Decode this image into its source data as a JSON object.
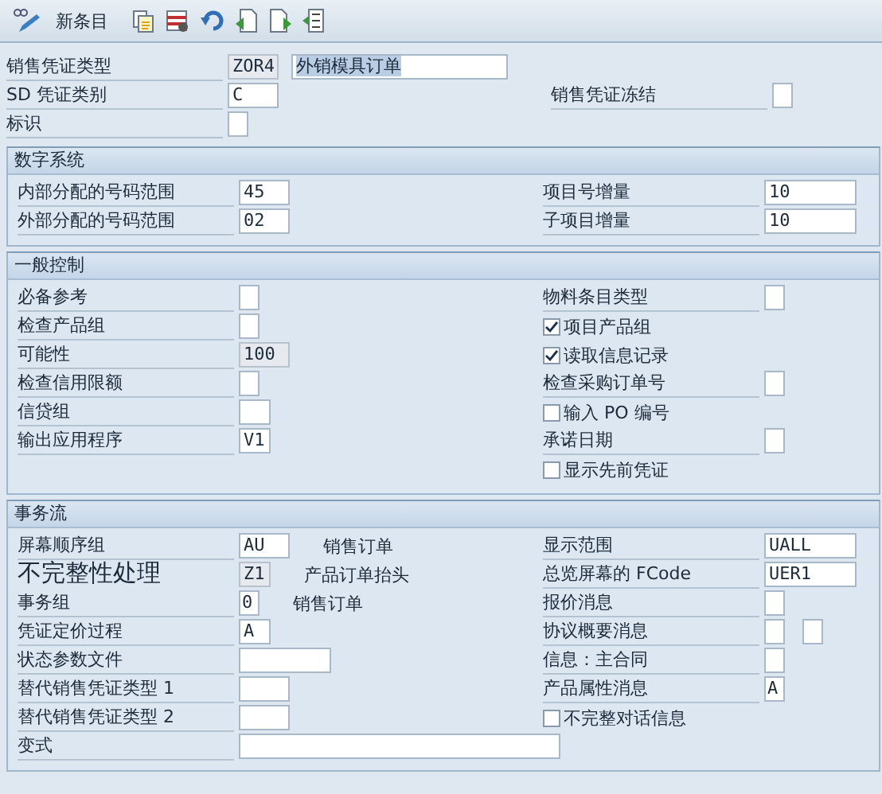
{
  "toolbar": {
    "button": "新条目"
  },
  "header": {
    "rows": [
      {
        "left": {
          "label": "销售凭证类型",
          "kind": "short",
          "value": "ZOR4",
          "readonly": true,
          "extra": {
            "kind": "input",
            "value": "外销模具订单",
            "selected": true
          }
        }
      },
      {
        "left": {
          "label": "SD 凭证类别",
          "kind": "short",
          "value": "C"
        },
        "right": {
          "label": "销售凭证冻结",
          "kind": "box"
        }
      },
      {
        "left": {
          "label": "标识",
          "kind": "box"
        }
      }
    ]
  },
  "sections": [
    {
      "title": "数字系统",
      "rows": [
        {
          "left": {
            "label": "内部分配的号码范围",
            "kind": "short",
            "value": "45"
          },
          "right": {
            "label": "项目号增量",
            "kind": "medium",
            "value": "10"
          }
        },
        {
          "left": {
            "label": "外部分配的号码范围",
            "kind": "short",
            "value": "02"
          },
          "right": {
            "label": "子项目增量",
            "kind": "medium",
            "value": "10"
          }
        }
      ]
    },
    {
      "title": "一般控制",
      "rows": [
        {
          "left": {
            "label": "必备参考",
            "kind": "box"
          },
          "right": {
            "label": "物料条目类型",
            "kind": "box"
          }
        },
        {
          "left": {
            "label": "检查产品组",
            "kind": "box"
          },
          "right": {
            "label": "项目产品组",
            "kind": "check",
            "checked": true
          }
        },
        {
          "left": {
            "label": "可能性",
            "kind": "short",
            "value": "100",
            "readonly": true
          },
          "right": {
            "label": "读取信息记录",
            "kind": "check",
            "checked": true
          }
        },
        {
          "left": {
            "label": "检查信用限额",
            "kind": "box"
          },
          "right": {
            "label": "检查采购订单号",
            "kind": "box"
          }
        },
        {
          "left": {
            "label": "信贷组",
            "kind": "tiny"
          },
          "right": {
            "label": "输入 PO 编号",
            "kind": "check",
            "checked": false
          }
        },
        {
          "left": {
            "label": "输出应用程序",
            "kind": "tiny",
            "value": "V1"
          },
          "right": {
            "label": "承诺日期",
            "kind": "box"
          }
        },
        {
          "right": {
            "label": "显示先前凭证",
            "kind": "check",
            "checked": false
          }
        }
      ]
    },
    {
      "title": "事务流",
      "rows": [
        {
          "left": {
            "label": "屏幕顺序组",
            "kind": "short",
            "value": "AU",
            "extra": {
              "kind": "text",
              "value": "销售订单"
            }
          },
          "right": {
            "label": "显示范围",
            "kind": "medium",
            "value": "UALL"
          }
        },
        {
          "left": {
            "label": "不完整性处理",
            "large": true,
            "kind": "tiny",
            "value": "Z1",
            "readonly": true,
            "extra": {
              "kind": "text",
              "value": "产品订单抬头"
            }
          },
          "right": {
            "label": "总览屏幕的 FCode",
            "kind": "medium",
            "value": "UER1"
          }
        },
        {
          "left": {
            "label": "事务组",
            "kind": "box",
            "value": "0",
            "extra": {
              "kind": "text",
              "value": "销售订单"
            }
          },
          "right": {
            "label": "报价消息",
            "kind": "box"
          }
        },
        {
          "left": {
            "label": "凭证定价过程",
            "kind": "tiny",
            "value": "A"
          },
          "right": {
            "label": "协议概要消息",
            "kind": "box",
            "extra": {
              "kind": "box"
            }
          }
        },
        {
          "left": {
            "label": "状态参数文件",
            "kind": "medium"
          },
          "right": {
            "label": "信息：主合同",
            "kind": "box"
          }
        },
        {
          "left": {
            "label": "替代销售凭证类型 1",
            "kind": "short"
          },
          "right": {
            "label": "产品属性消息",
            "kind": "box",
            "value": "A"
          }
        },
        {
          "left": {
            "label": "替代销售凭证类型 2",
            "kind": "short"
          },
          "right": {
            "label": "不完整对话信息",
            "kind": "check",
            "checked": false
          }
        },
        {
          "left": {
            "label": "变式",
            "kind": "long"
          }
        }
      ]
    }
  ]
}
